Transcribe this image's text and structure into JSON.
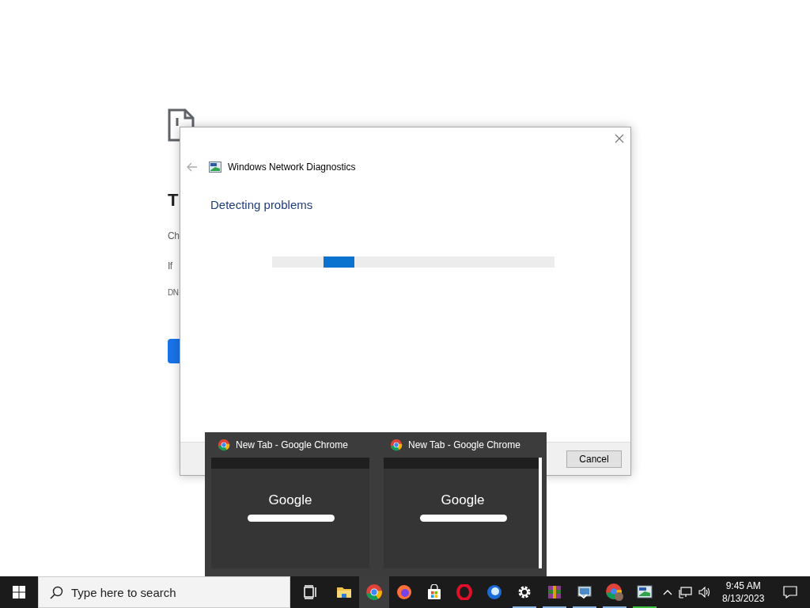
{
  "error_page": {
    "title": "T",
    "lines": [
      "Ch",
      "If",
      "DN"
    ]
  },
  "dialog": {
    "app_title": "Windows Network Diagnostics",
    "heading": "Detecting problems",
    "progress": {
      "indeterminate": true
    },
    "buttons": [
      {
        "label": "Cancel"
      }
    ]
  },
  "thumbnails": [
    {
      "title": "New Tab - Google Chrome",
      "logo": "Google"
    },
    {
      "title": "New Tab - Google Chrome",
      "logo": "Google"
    }
  ],
  "taskbar": {
    "search": {
      "placeholder": "Type here to search"
    },
    "apps": [
      {
        "kind": "taskview",
        "running": false,
        "attention": false,
        "selected": false
      },
      {
        "kind": "folder",
        "running": false,
        "attention": false,
        "selected": false
      },
      {
        "kind": "chrome",
        "running": false,
        "attention": false,
        "selected": true
      },
      {
        "kind": "firefox",
        "running": false,
        "attention": false,
        "selected": false
      },
      {
        "kind": "store",
        "running": false,
        "attention": false,
        "selected": false
      },
      {
        "kind": "opera",
        "running": false,
        "attention": false,
        "selected": false
      },
      {
        "kind": "thunderbird",
        "running": false,
        "attention": false,
        "selected": false
      },
      {
        "kind": "settings",
        "running": true,
        "attention": false,
        "selected": false
      },
      {
        "kind": "archive",
        "running": true,
        "attention": false,
        "selected": false
      },
      {
        "kind": "remote",
        "running": true,
        "attention": false,
        "selected": false
      },
      {
        "kind": "chrome-profile",
        "running": true,
        "attention": false,
        "selected": false
      },
      {
        "kind": "diagnostics",
        "running": true,
        "attention": true,
        "selected": false
      }
    ],
    "clock": {
      "time": "9:45 AM",
      "date": "8/13/2023"
    }
  }
}
